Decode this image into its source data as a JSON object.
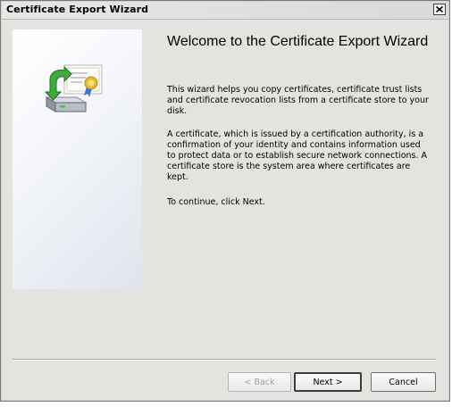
{
  "window": {
    "title": "Certificate Export Wizard",
    "close_icon": "close-icon"
  },
  "main": {
    "heading": "Welcome to the Certificate Export Wizard",
    "paragraph1": "This wizard helps you copy certificates, certificate trust lists and certificate revocation lists from a certificate store to your disk.",
    "paragraph2": "A certificate, which is issued by a certification authority, is a confirmation of your identity and contains information used to protect data or to establish secure network connections. A certificate store is the system area where certificates are kept.",
    "paragraph3": "To continue, click Next."
  },
  "side_panel": {
    "icon": "certificate-export-icon"
  },
  "buttons": {
    "back": "< Back",
    "next": "Next >",
    "cancel": "Cancel"
  }
}
